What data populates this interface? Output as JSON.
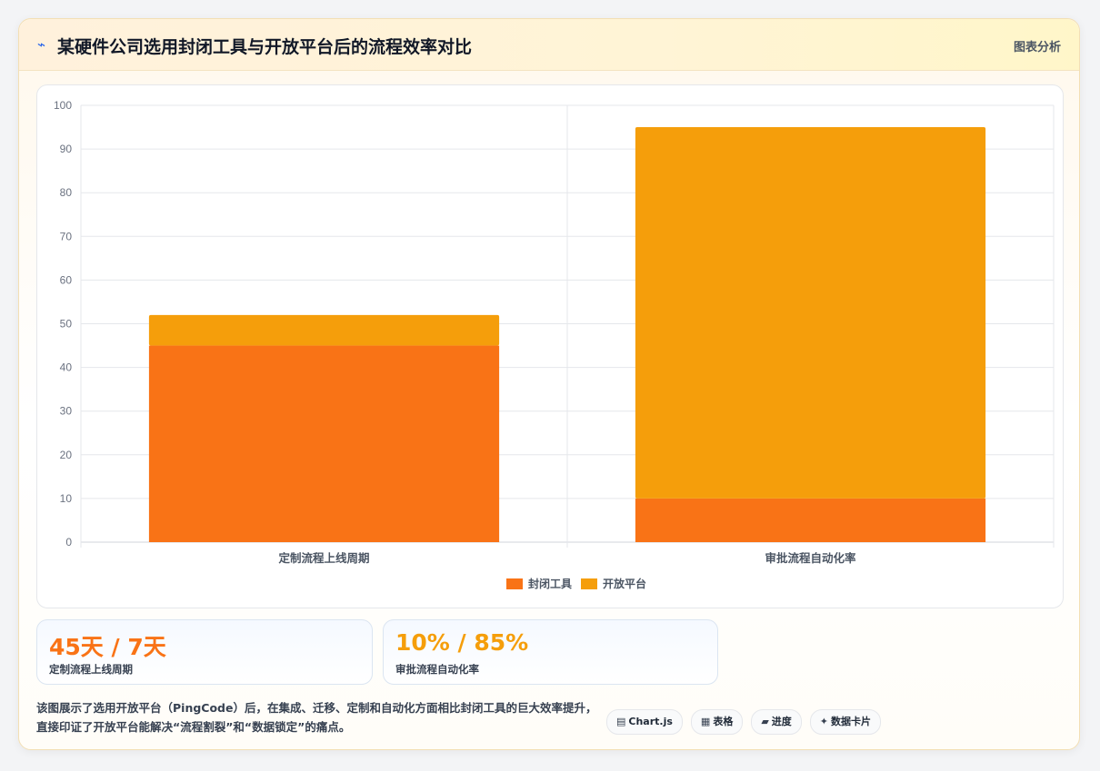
{
  "header": {
    "icon": "chart-line-icon",
    "title": "某硬件公司选用封闭工具与开放平台后的流程效率对比",
    "tag": "图表分析"
  },
  "chart_data": {
    "type": "bar",
    "stacked": true,
    "categories": [
      "定制流程上线周期",
      "审批流程自动化率"
    ],
    "series": [
      {
        "name": "封闭工具",
        "values": [
          45,
          10
        ],
        "color": "#f97316"
      },
      {
        "name": "开放平台",
        "values": [
          7,
          85
        ],
        "color": "#f59e0b"
      }
    ],
    "ylim": [
      0,
      100
    ],
    "yticks": [
      0,
      10,
      20,
      30,
      40,
      50,
      60,
      70,
      80,
      90,
      100
    ],
    "grid": true,
    "legend": "bottom"
  },
  "stats": [
    {
      "value": "45天 / 7天",
      "label": "定制流程上线周期",
      "color": "#f97316"
    },
    {
      "value": "10% / 85%",
      "label": "审批流程自动化率",
      "color": "#f59e0b"
    }
  ],
  "description": "该图展示了选用开放平台（PingCode）后，在集成、迁移、定制和自动化方面相比封闭工具的巨大效率提升，直接印证了开放平台能解决“流程割裂”和“数据锁定”的痛点。",
  "badges": [
    {
      "icon": "chart-icon",
      "glyph": "▤",
      "label": "Chart.js"
    },
    {
      "icon": "table-icon",
      "glyph": "▦",
      "label": "表格"
    },
    {
      "icon": "progress-icon",
      "glyph": "▰",
      "label": "进度"
    },
    {
      "icon": "sparkle-icon",
      "glyph": "✦",
      "label": "数据卡片"
    }
  ]
}
